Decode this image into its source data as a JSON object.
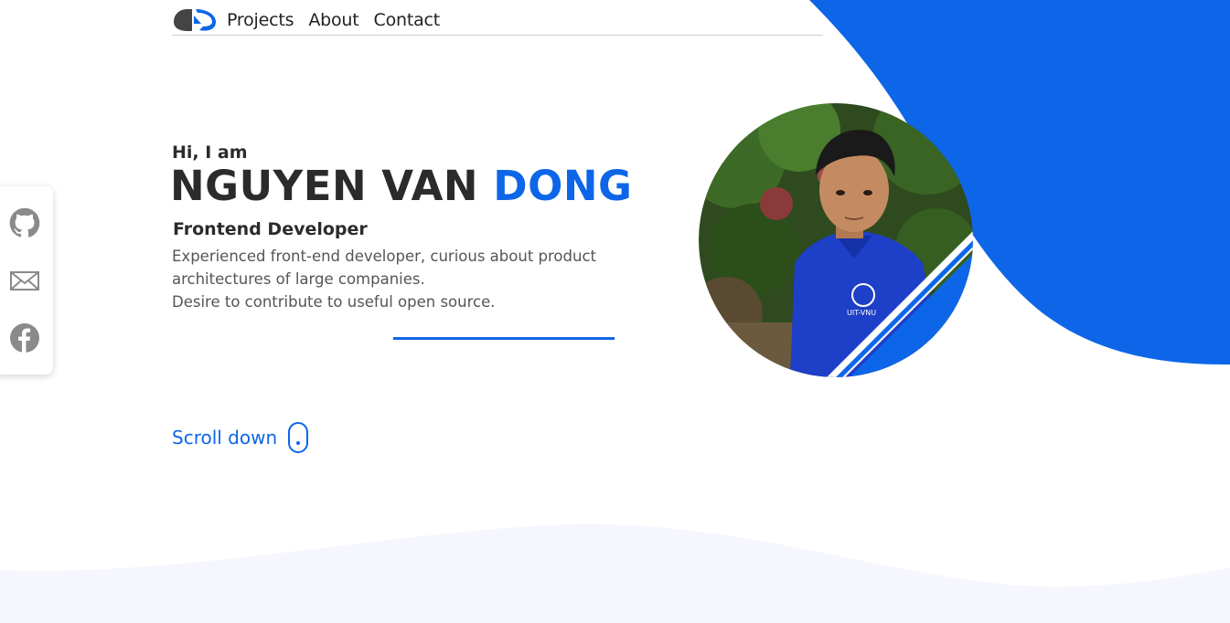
{
  "header": {
    "logo_alt": "logo",
    "nav": [
      {
        "label": "Projects"
      },
      {
        "label": "About"
      },
      {
        "label": "Contact"
      }
    ]
  },
  "hero": {
    "greeting": "Hi, I am",
    "name_first": "NGUYEN VAN ",
    "name_accent": "DONG",
    "role": "Frontend Developer",
    "description_lines": [
      "Experienced front-end developer, curious about product",
      "architectures of large companies.",
      "Desire to contribute to useful open source."
    ]
  },
  "scroll": {
    "label": "Scroll down"
  },
  "social": [
    {
      "icon": "github-icon"
    },
    {
      "icon": "mail-icon"
    },
    {
      "icon": "facebook-icon"
    }
  ],
  "avatar": {
    "shirt_text": "UIT-VNU"
  },
  "colors": {
    "accent": "#0d66e8",
    "text": "#2b2b2b",
    "muted": "#555555",
    "icon_gray": "#8a8a8a"
  }
}
